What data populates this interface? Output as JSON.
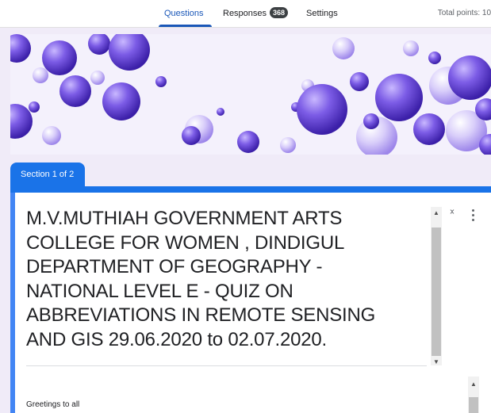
{
  "tabs": {
    "questions": "Questions",
    "responses": "Responses",
    "responses_count": "368",
    "settings": "Settings"
  },
  "total_points": "Total points: 10",
  "section": {
    "label": "Section 1 of 2"
  },
  "form": {
    "title": "M.V.MUTHIAH GOVERNMENT ARTS\nCOLLEGE FOR WOMEN , DINDIGUL\nDEPARTMENT OF GEOGRAPHY -\nNATIONAL LEVEL E - QUIZ ON\nABBREVIATIONS IN REMOTE SENSING\nAND GIS 29.06.2020 to 02.07.2020.",
    "description": "Greetings to all"
  },
  "colors": {
    "accent": "#1a73e8",
    "tab_active": "#1a57b8",
    "background": "#f0ebf8",
    "banner_sphere": "#7c5ce6"
  },
  "icons": [
    "collapse-icon",
    "more-vert-icon",
    "scroll-up-arrow",
    "scroll-down-arrow"
  ]
}
